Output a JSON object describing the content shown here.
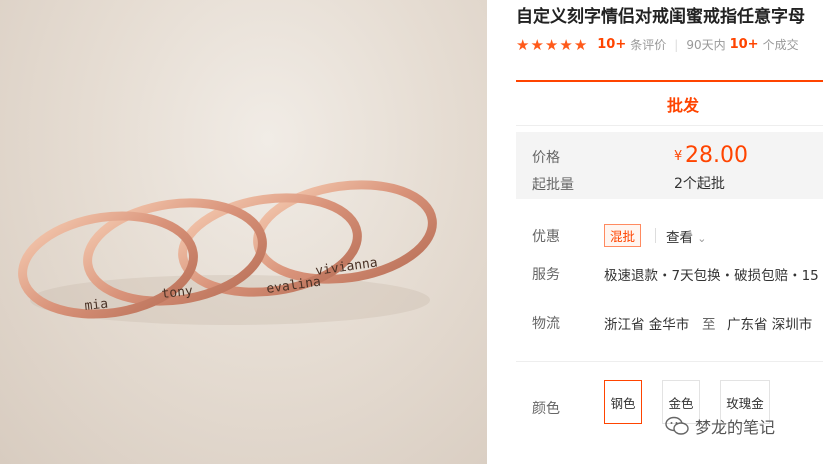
{
  "product": {
    "title": "自定义刻字情侣对戒闺蜜戒指任意字母",
    "rating_stars": 5,
    "review_count": "10+",
    "review_label": "条评价",
    "sales_prefix": "90天内",
    "sales_count": "10+",
    "sales_suffix": "个成交"
  },
  "tabs": {
    "wholesale": "批发"
  },
  "price": {
    "label": "价格",
    "currency": "¥",
    "value": "28.00",
    "moq_label": "起批量",
    "moq_value": "2个起批"
  },
  "promo": {
    "label": "优惠",
    "badge": "混批",
    "view_more": "查看"
  },
  "service": {
    "label": "服务",
    "text": "极速退款・7天包换・破损包赔・15"
  },
  "logistics": {
    "label": "物流",
    "from": "浙江省 金华市",
    "to_word": "至",
    "dest": "广东省 深圳市"
  },
  "color": {
    "label": "颜色",
    "options": [
      "钢色",
      "金色",
      "玫瑰金"
    ],
    "selected": "钢色"
  },
  "image": {
    "engravings": [
      "mia",
      "tony",
      "evalina",
      "vivianna"
    ]
  },
  "watermark": {
    "text": "梦龙的笔记"
  },
  "colors": {
    "accent": "#ff4400",
    "ring": "#d99a7a"
  }
}
